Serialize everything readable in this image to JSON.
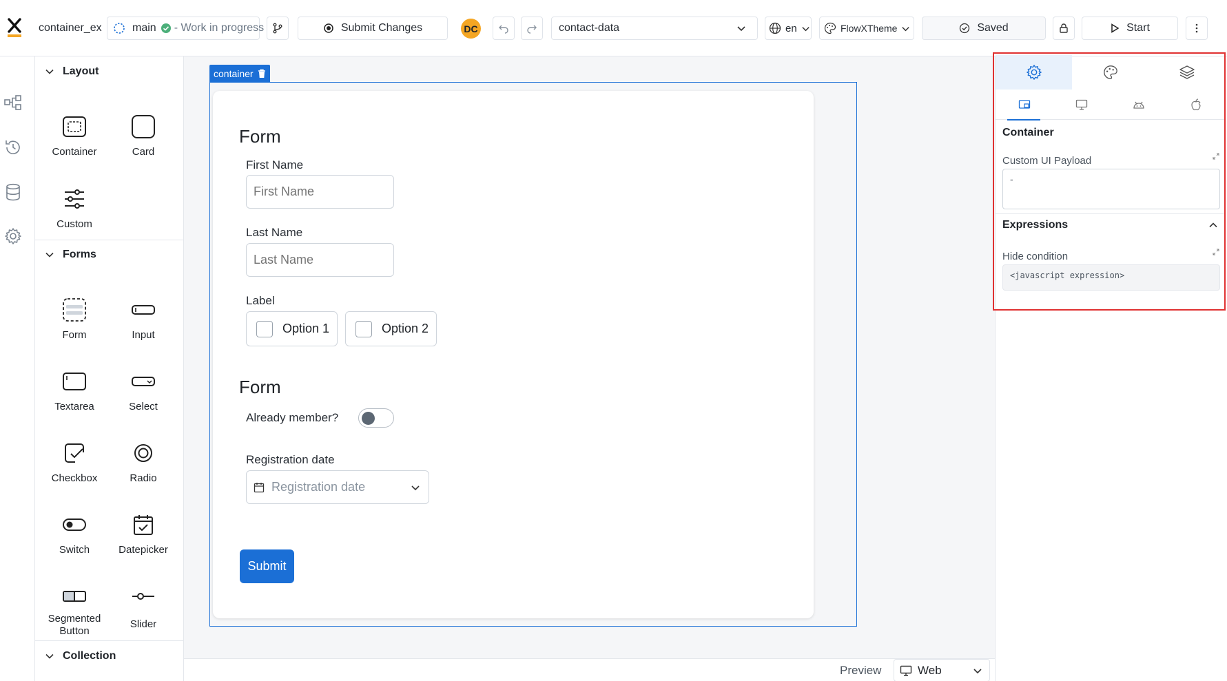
{
  "topbar": {
    "logo": "x",
    "process_name": "container_ex",
    "branch": "main",
    "status": "- Work in progress",
    "submit_label": "Submit Changes",
    "avatar_initials": "DC",
    "data_model": "contact-data",
    "language": "en",
    "theme": "FlowXTheme",
    "saved_label": "Saved",
    "start_label": "Start"
  },
  "rail": {
    "icons": [
      "flow-icon",
      "history-icon",
      "database-icon",
      "gear-icon"
    ]
  },
  "palette": {
    "sections": [
      {
        "title": "Layout",
        "items": [
          "Container",
          "Card",
          "Custom"
        ]
      },
      {
        "title": "Forms",
        "items": [
          "Form",
          "Input",
          "Textarea",
          "Select",
          "Checkbox",
          "Radio",
          "Switch",
          "Datepicker",
          "Segmented Button",
          "Slider"
        ]
      },
      {
        "title": "Collection",
        "items": []
      }
    ]
  },
  "canvas": {
    "selected_tag": "container",
    "form1": {
      "title": "Form",
      "first_name_label": "First Name",
      "first_name_placeholder": "First Name",
      "last_name_label": "Last Name",
      "last_name_placeholder": "Last Name",
      "checkbox_group_label": "Label",
      "options": [
        "Option 1",
        "Option 2"
      ]
    },
    "form2": {
      "title": "Form",
      "switch_label": "Already member?",
      "date_label": "Registration date",
      "date_placeholder": "Registration date"
    },
    "submit_label": "Submit",
    "preview_label": "Preview",
    "preview_target": "Web"
  },
  "properties": {
    "section_title": "Container",
    "payload_label": "Custom UI Payload",
    "payload_value": "-",
    "expressions_title": "Expressions",
    "hide_condition_label": "Hide condition",
    "hide_condition_placeholder": "<javascript expression>"
  },
  "colors": {
    "accent": "#1b6fd6",
    "highlight_frame": "#e03131",
    "avatar_bg": "#f5a623",
    "logo_bar": "#f5a623"
  }
}
